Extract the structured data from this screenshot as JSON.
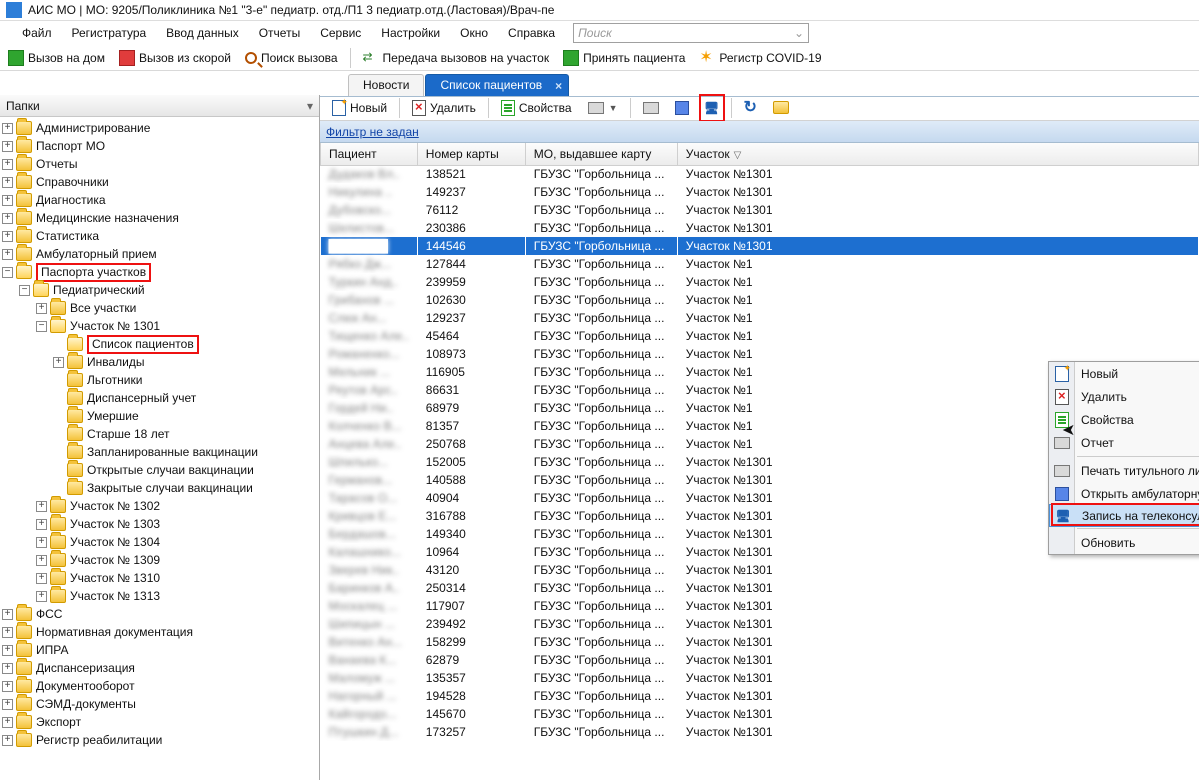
{
  "title": "АИС МО | МО: 9205/Поликлиника №1 \"3-е\" педиатр. отд./П1 3 педиатр.отд.(Ластовая)/Врач-пе",
  "menu": [
    "Файл",
    "Регистратура",
    "Ввод данных",
    "Отчеты",
    "Сервис",
    "Настройки",
    "Окно",
    "Справка"
  ],
  "search_placeholder": "Поиск",
  "toolbar": [
    {
      "label": "Вызов на дом",
      "icon": "green"
    },
    {
      "label": "Вызов из скорой",
      "icon": "red"
    },
    {
      "label": "Поиск вызова",
      "icon": "search"
    },
    {
      "label": "Передача вызовов на участок",
      "icon": "arrow"
    },
    {
      "label": "Принять пациента",
      "icon": "green"
    },
    {
      "label": "Регистр COVID-19",
      "icon": "star"
    }
  ],
  "tab_inactive": "Новости",
  "tab_active": "Список пациентов",
  "sidebar_title": "Папки",
  "tree": {
    "root": [
      "Администрирование",
      "Паспорт МО",
      "Отчеты",
      "Справочники",
      "Диагностика",
      "Медицинские назначения",
      "Статистика",
      "Амбулаторный прием"
    ],
    "passport": "Паспорта участков",
    "pediatric": "Педиатрический",
    "all": "Все участки",
    "u1301": "Участок № 1301",
    "spisok": "Список пациентов",
    "sub1301": [
      "Инвалиды",
      "Льготники",
      "Диспансерный учет",
      "Умершие",
      "Старше 18 лет",
      "Запланированные вакцинации",
      "Открытые случаи вакцинации",
      "Закрытые случаи вакцинации"
    ],
    "uchastki": [
      "Участок № 1302",
      "Участок № 1303",
      "Участок № 1304",
      "Участок № 1309",
      "Участок № 1310",
      "Участок № 1313"
    ],
    "tail": [
      "ФСС",
      "Нормативная документация",
      "ИПРА",
      "Диспансеризация",
      "Документооборот",
      "СЭМД-документы",
      "Экспорт",
      "Регистр реабилитации"
    ]
  },
  "pane_buttons": {
    "new": "Новый",
    "del": "Удалить",
    "prop": "Свойства"
  },
  "filter": "Фильтр не задан",
  "grid_headers": [
    "Пациент",
    "Номер карты",
    "МО, выдавшее карту",
    "Участок"
  ],
  "mo_text": "ГБУЗС \"Горбольница ...",
  "uch_text": "Участок №1301",
  "uch_text_cut": "Участок №1",
  "rows": [
    [
      "Дудаков Вл..",
      "138521"
    ],
    [
      "Никулина ..",
      "149237"
    ],
    [
      "Дубовско...",
      "76112"
    ],
    [
      "Шелистов...",
      "230386"
    ],
    [
      "",
      "144546"
    ],
    [
      "Рябко Дж...",
      "127844"
    ],
    [
      "Туркин Анд..",
      "239959"
    ],
    [
      "Грибанов ...",
      "102630"
    ],
    [
      "Слюк Ан...",
      "129237"
    ],
    [
      "Тищенко Але..",
      "45464"
    ],
    [
      "Романенко...",
      "108973"
    ],
    [
      "Мельник ...",
      "116905"
    ],
    [
      "Реутов Арс..",
      "86631"
    ],
    [
      "Гордей Ни..",
      "68979"
    ],
    [
      "Колченко В...",
      "81357"
    ],
    [
      "Анцева Але..",
      "250768"
    ],
    [
      "Шпилько...",
      "152005"
    ],
    [
      "Германов...",
      "140588"
    ],
    [
      "Тарасов О...",
      "40904"
    ],
    [
      "Кривцов Е...",
      "316788"
    ],
    [
      "Бердашов...",
      "149340"
    ],
    [
      "Калашнико...",
      "10964"
    ],
    [
      "Зверев Ник..",
      "43120"
    ],
    [
      "Баринков А..",
      "250314"
    ],
    [
      "Москалец ...",
      "117907"
    ],
    [
      "Шипицын ...",
      "239492"
    ],
    [
      "Витенко Ан...",
      "158299"
    ],
    [
      "Ванаева К...",
      "62879"
    ],
    [
      "Маломуж ...",
      "135357"
    ],
    [
      "Нагорный ...",
      "194528"
    ],
    [
      "Кайгородо...",
      "145670"
    ],
    [
      "Птушкин Д...",
      "173257"
    ]
  ],
  "selected_row_index": 4,
  "context_menu": {
    "items": [
      {
        "icon": "new",
        "label": "Новый"
      },
      {
        "icon": "del",
        "label": "Удалить"
      },
      {
        "icon": "prop",
        "label": "Свойства"
      },
      {
        "icon": "print",
        "label": "Отчет",
        "submenu": true
      },
      {
        "sep": true
      },
      {
        "icon": "print",
        "label": "Печать титульного листа"
      },
      {
        "icon": "book",
        "label": "Открыть амбулаторную карту"
      },
      {
        "icon": "tele",
        "label": "Запись на телеконсультацию (первичный прием)",
        "hover": true,
        "highlight": true
      },
      {
        "sep": true
      },
      {
        "icon": "",
        "label": "Обновить"
      }
    ]
  }
}
